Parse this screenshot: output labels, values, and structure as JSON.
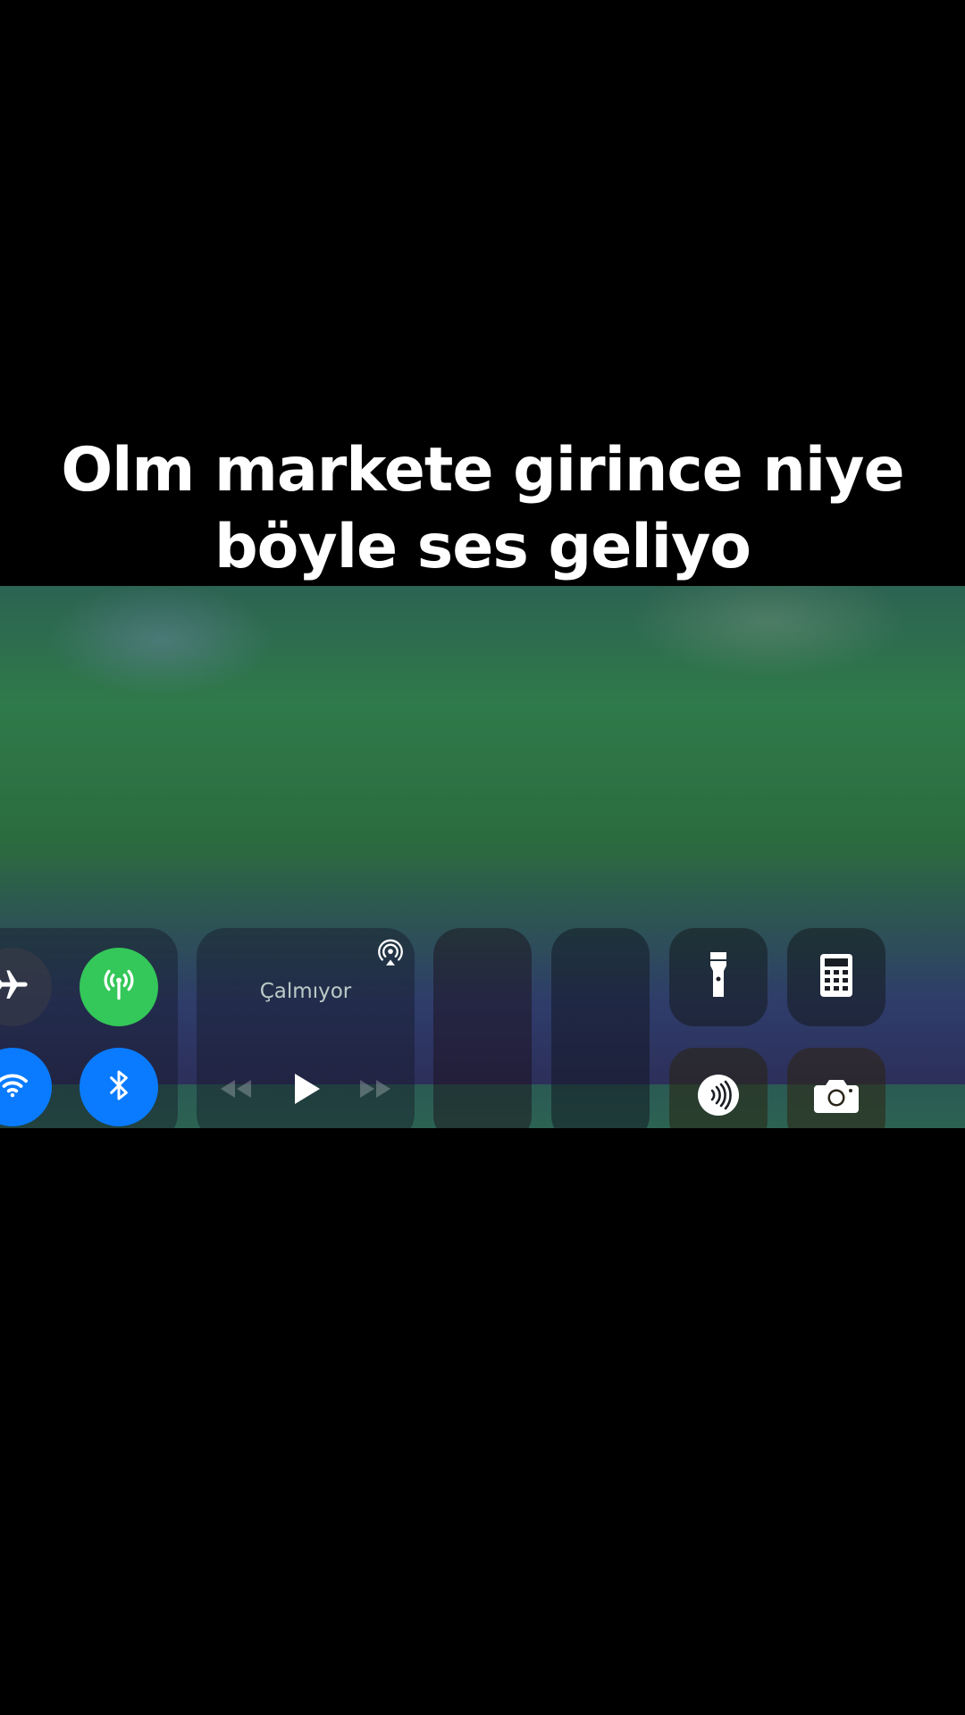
{
  "caption": {
    "line1": "Olm markete girince niye",
    "line2": "böyle ses geliyo"
  },
  "control_center": {
    "connectivity": {
      "airplane": {
        "icon": "airplane-icon",
        "active": false
      },
      "cellular": {
        "icon": "cellular-antenna-icon",
        "active": true,
        "color": "#34c759"
      },
      "wifi": {
        "icon": "wifi-icon",
        "active": true,
        "color": "#0a7bff"
      },
      "bluetooth": {
        "icon": "bluetooth-icon",
        "active": true,
        "color": "#0a7bff"
      }
    },
    "now_playing": {
      "status": "Çalmıyor",
      "airplay_icon": "airplay-icon",
      "rewind_icon": "rewind-icon",
      "play_icon": "play-icon",
      "forward_icon": "fast-forward-icon"
    },
    "sliders": {
      "brightness": {
        "level": 0
      },
      "volume": {
        "level": 0.05
      }
    },
    "shortcuts": [
      {
        "name": "flashlight",
        "icon": "flashlight-icon"
      },
      {
        "name": "calculator",
        "icon": "calculator-icon"
      },
      {
        "name": "nfc",
        "icon": "nfc-icon"
      },
      {
        "name": "camera",
        "icon": "camera-icon"
      }
    ]
  }
}
